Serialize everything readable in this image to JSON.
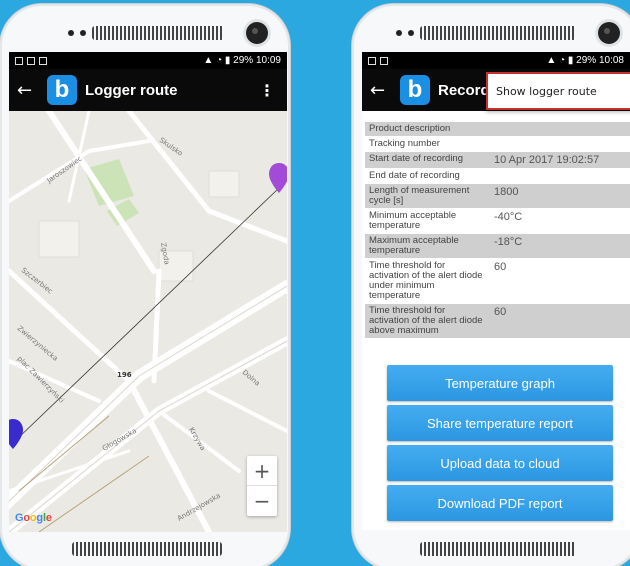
{
  "colors": {
    "background": "#2aa8df",
    "accent": "#1a8fe3",
    "button": "#36a2ea",
    "popup_border": "#c9302c"
  },
  "left_phone": {
    "status_time": "10:09",
    "status_battery": "29%",
    "title": "Logger route",
    "icons": {
      "back": "arrow-left-icon",
      "menu": "more-vert-icon"
    },
    "map": {
      "labels": [
        "Jaroszowiec",
        "Skulsko",
        "Szczerbiec",
        "Zgoda",
        "Zwierzyniecka",
        "plac Zawierzyński",
        "196",
        "Głogowska",
        "Krzywa",
        "Dolna",
        "Andrzejowska"
      ],
      "zoom_in": "+",
      "zoom_out": "−",
      "logo": "Google"
    }
  },
  "right_phone": {
    "status_time": "10:08",
    "status_battery": "29%",
    "title": "Record",
    "popup_item": "Show logger route",
    "rows": [
      {
        "label": "Product description",
        "value": ""
      },
      {
        "label": "Tracking number",
        "value": ""
      },
      {
        "label": "Start date of recording",
        "value": "10 Apr 2017 19:02:57"
      },
      {
        "label": "End date of recording",
        "value": ""
      },
      {
        "label": "Length of measurement cycle [s]",
        "value": "1800"
      },
      {
        "label": "Minimum acceptable temperature",
        "value": "-40°C"
      },
      {
        "label": "Maximum acceptable temperature",
        "value": "-18°C"
      },
      {
        "label": "Time threshold for activation of the alert diode under minimum temperature",
        "value": "60"
      },
      {
        "label": "Time threshold for activation of the alert diode above maximum",
        "value": "60"
      }
    ],
    "buttons": [
      "Temperature graph",
      "Share temperature report",
      "Upload data to cloud",
      "Download PDF report"
    ]
  }
}
